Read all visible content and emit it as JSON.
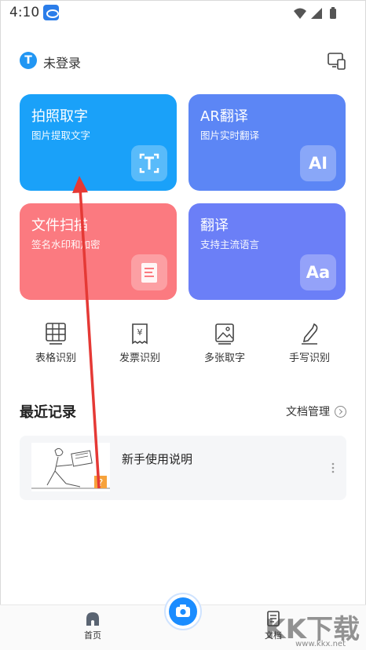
{
  "status_bar": {
    "time": "4:10"
  },
  "header": {
    "login_label": "未登录",
    "logo_letter": "T"
  },
  "cards": [
    {
      "title": "拍照取字",
      "subtitle": "图片提取文字",
      "icon": "text-scan-icon",
      "glyph": "T",
      "color": "#1aa1f9"
    },
    {
      "title": "AR翻译",
      "subtitle": "图片实时翻译",
      "icon": "ai-icon",
      "glyph": "AI",
      "color": "#5c86f5"
    },
    {
      "title": "文件扫描",
      "subtitle": "签名水印和加密",
      "icon": "document-icon",
      "glyph": "",
      "color": "#fb7a80"
    },
    {
      "title": "翻译",
      "subtitle": "支持主流语言",
      "icon": "aa-icon",
      "glyph": "Aa",
      "color": "#6b7ff7"
    }
  ],
  "tools": [
    {
      "label": "表格识别",
      "icon": "table-icon"
    },
    {
      "label": "发票识别",
      "icon": "invoice-icon"
    },
    {
      "label": "多张取字",
      "icon": "images-icon"
    },
    {
      "label": "手写识别",
      "icon": "pen-icon"
    }
  ],
  "recent": {
    "title": "最近记录",
    "manage_label": "文档管理",
    "items": [
      {
        "title": "新手使用说明"
      }
    ]
  },
  "nav": {
    "home_label": "首页",
    "docs_label": "文档"
  },
  "watermark": {
    "text": "KK下载",
    "url": "www.kkx.net"
  }
}
